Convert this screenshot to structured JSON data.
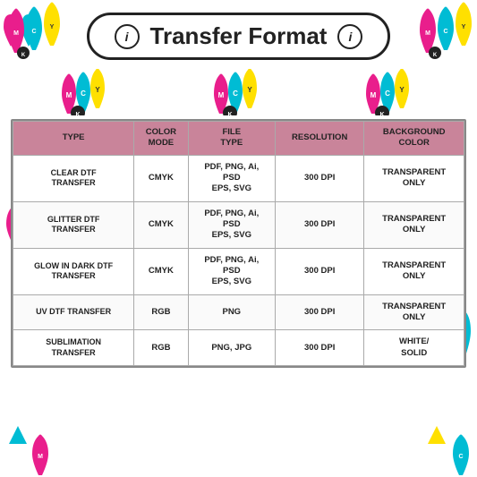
{
  "page": {
    "title": "Transfer Format",
    "info_icon_label": "i",
    "background_color": "#ffffff"
  },
  "table": {
    "headers": [
      "TYPE",
      "COLOR\nMODE",
      "FILE\nTYPE",
      "RESOLUTION",
      "BACKGROUND\nCOLOR"
    ],
    "rows": [
      {
        "type": "CLEAR DTF\nTRANSFER",
        "color_mode": "CMYK",
        "file_type": "PDF, PNG, Ai,\nPSD\nEPS, SVG",
        "resolution": "300 DPI",
        "background_color": "TRANSPARENT\nONLY"
      },
      {
        "type": "GLITTER DTF\nTRANSFER",
        "color_mode": "CMYK",
        "file_type": "PDF, PNG, Ai,\nPSD\nEPS, SVG",
        "resolution": "300 DPI",
        "background_color": "TRANSPARENT\nONLY"
      },
      {
        "type": "GLOW IN DARK DTF\nTRANSFER",
        "color_mode": "CMYK",
        "file_type": "PDF, PNG, Ai,\nPSD\nEPS, SVG",
        "resolution": "300 DPI",
        "background_color": "TRANSPARENT\nONLY"
      },
      {
        "type": "UV DTF TRANSFER",
        "color_mode": "RGB",
        "file_type": "PNG",
        "resolution": "300 DPI",
        "background_color": "TRANSPARENT\nONLY"
      },
      {
        "type": "SUBLIMATION\nTRANSFER",
        "color_mode": "RGB",
        "file_type": "PNG, JPG",
        "resolution": "300 DPI",
        "background_color": "WHITE/\nSOLID"
      }
    ]
  },
  "colors": {
    "cyan": "#00bcd4",
    "magenta": "#e91e8c",
    "yellow": "#ffe000",
    "black": "#222222",
    "header_bg": "#c9849a",
    "accent_pink": "#e91e8c",
    "accent_cyan": "#00bcd4"
  },
  "drop_groups": [
    {
      "letters": [
        "C",
        "Y",
        "M",
        "K"
      ],
      "position": "top-left"
    },
    {
      "letters": [
        "C",
        "Y",
        "M",
        "K"
      ],
      "position": "top-center"
    },
    {
      "letters": [
        "C",
        "Y",
        "M",
        "K"
      ],
      "position": "top-right"
    }
  ]
}
